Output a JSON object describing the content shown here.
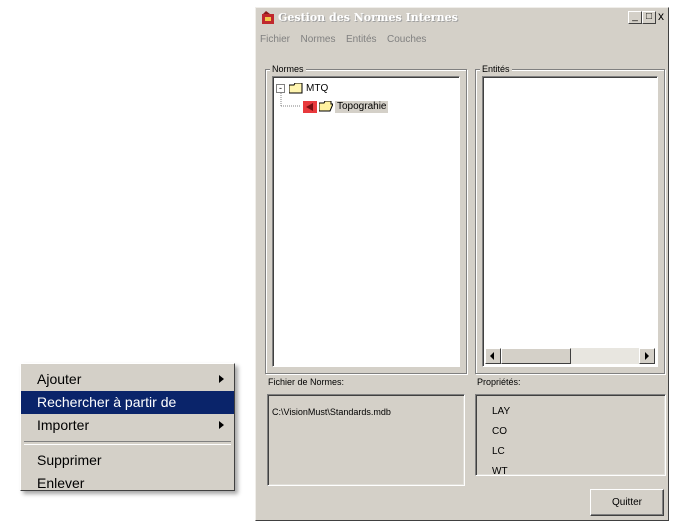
{
  "context_menu": {
    "items": [
      {
        "label": "Ajouter",
        "has_submenu": true,
        "highlighted": false
      },
      {
        "label": "Rechercher à partir de",
        "has_submenu": false,
        "highlighted": true
      },
      {
        "label": "Importer",
        "has_submenu": true,
        "highlighted": false
      },
      {
        "label": "Supprimer",
        "has_submenu": false,
        "highlighted": false
      },
      {
        "label": "Enlever",
        "has_submenu": false,
        "highlighted": false
      }
    ],
    "highlight_color": "#0a246a"
  },
  "window": {
    "title": "Gestion des Normes Internes",
    "controls": {
      "minimize": "_",
      "maximize": "□",
      "close": "x"
    },
    "menu": [
      "Fichier",
      "Normes",
      "Entités",
      "Couches"
    ],
    "normes_group": {
      "label": "Normes",
      "tree": {
        "root": {
          "label": "MTQ",
          "expanded": true,
          "icon": "folder-icon"
        },
        "child": {
          "label": "Topograhie",
          "icon": "folder-icon",
          "selected": true
        }
      }
    },
    "entites_group": {
      "label": "Entités"
    },
    "fichier_label": "Fichier de Normes:",
    "fichier_value": "C:\\VisionMust\\Standards.mdb",
    "proprietes_label": "Propriétés:",
    "proprietes": [
      "LAY",
      "CO",
      "LC",
      "WT"
    ],
    "quit_label": "Quitter"
  }
}
